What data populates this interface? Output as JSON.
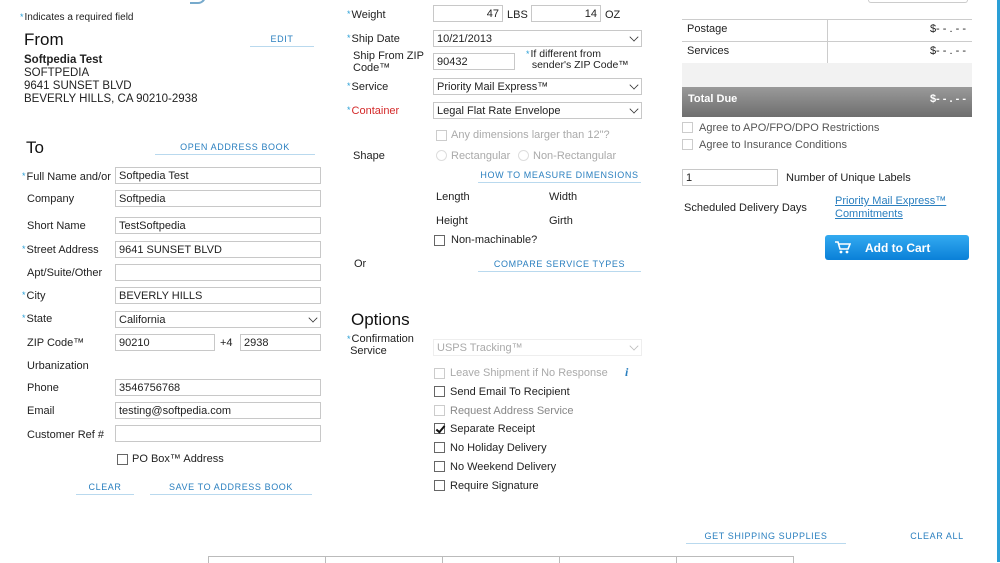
{
  "header": {
    "required_note": "Indicates a required field"
  },
  "from": {
    "heading": "From",
    "edit_label": "EDIT",
    "name": "Softpedia Test",
    "company": "SOFTPEDIA",
    "street": "9641 SUNSET BLVD",
    "city_line": "BEVERLY HILLS, CA 90210-2938"
  },
  "to": {
    "heading": "To",
    "open_address_book": "OPEN ADDRESS BOOK",
    "full_name_label": "Full Name and/or",
    "full_name": "Softpedia Test",
    "company_label": "Company",
    "company": "Softpedia",
    "short_name_label": "Short Name",
    "short_name": "TestSoftpedia",
    "street_label": "Street Address",
    "street": "9641 SUNSET BLVD",
    "apt_label": "Apt/Suite/Other",
    "apt": "",
    "city_label": "City",
    "city": "BEVERLY HILLS",
    "state_label": "State",
    "state": "California",
    "zip_label": "ZIP Code™",
    "zip": "90210",
    "plus4_label": "+4",
    "plus4": "2938",
    "urbanization_label": "Urbanization",
    "phone_label": "Phone",
    "phone": "3546756768",
    "email_label": "Email",
    "email": "testing@softpedia.com",
    "customer_ref_label": "Customer Ref #",
    "customer_ref": "",
    "po_box_label": "PO Box™ Address",
    "clear_label": "CLEAR",
    "save_label": "SAVE TO ADDRESS BOOK"
  },
  "package": {
    "weight_label": "Weight",
    "weight_lbs": "47",
    "lbs_unit": "LBS",
    "weight_oz": "14",
    "oz_unit": "OZ",
    "ship_date_label": "Ship Date",
    "ship_date": "10/21/2013",
    "ship_from_zip_label_1": "Ship From ZIP",
    "ship_from_zip_label_2": "Code™",
    "ship_from_zip": "90432",
    "if_different_1": "If different from",
    "if_different_2": "sender's ZIP Code™",
    "service_label": "Service",
    "service": "Priority Mail Express™",
    "container_label": "Container",
    "container": "Legal Flat Rate Envelope",
    "dims_larger": "Any dimensions larger than 12\"?",
    "shape_label": "Shape",
    "shape_rect": "Rectangular",
    "shape_nonrect": "Non-Rectangular",
    "how_to_measure": "HOW TO MEASURE DIMENSIONS",
    "length_label": "Length",
    "width_label": "Width",
    "height_label": "Height",
    "girth_label": "Girth",
    "non_machinable": "Non-machinable?",
    "or_label": "Or",
    "compare_services": "COMPARE SERVICE TYPES"
  },
  "options": {
    "heading": "Options",
    "confirmation_label_1": "Confirmation",
    "confirmation_label_2": "Service",
    "confirmation_value": "USPS Tracking™",
    "leave_shipment": "Leave Shipment if No Response",
    "info_icon": "i",
    "send_email": "Send Email To Recipient",
    "request_address": "Request Address Service",
    "separate_receipt": "Separate Receipt",
    "no_holiday": "No Holiday Delivery",
    "no_weekend": "No Weekend Delivery",
    "require_signature": "Require Signature"
  },
  "summary": {
    "postage_label": "Postage",
    "postage_value": "$- - . - -",
    "services_label": "Services",
    "services_value": "$- - . - -",
    "total_label": "Total Due",
    "total_value": "$- - . - -",
    "apo_label": "Agree to APO/FPO/DPO Restrictions",
    "insurance_label": "Agree to Insurance Conditions",
    "labels_count": "1",
    "labels_label": "Number of Unique Labels",
    "delivery_days_label": "Scheduled Delivery Days",
    "commitments_link_1": "Priority Mail Express™",
    "commitments_link_2": "Commitments",
    "add_to_cart": "Add to Cart",
    "get_supplies": "GET SHIPPING SUPPLIES",
    "clear_all": "CLEAR ALL"
  },
  "colors": {
    "accent": "#2a9fd6",
    "link": "#2a7fbf",
    "container_label": "#d42a2a",
    "total_bar": "#7a7a7a"
  }
}
